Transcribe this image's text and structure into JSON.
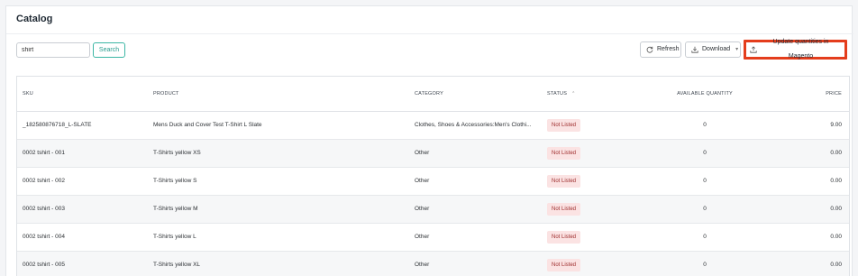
{
  "page": {
    "title": "Catalog"
  },
  "search": {
    "value": "shirt",
    "button_label": "Search"
  },
  "toolbar": {
    "refresh_label": "Refresh",
    "download_label": "Download",
    "update_label": "Update quantities in Magento"
  },
  "table": {
    "headers": {
      "sku": "SKU",
      "product": "PRODUCT",
      "category": "CATEGORY",
      "status": "STATUS",
      "available_quantity": "AVAILABLE QUANTITY",
      "price": "PRICE"
    },
    "rows": [
      {
        "sku": "_182580876718_L-SLATE",
        "product": "Mens Duck and Cover Test T-Shirt L Slate",
        "category": "Clothes, Shoes & Accessories:Men's Clothi...",
        "status": "Not Listed",
        "quantity": "0",
        "price": "9.00"
      },
      {
        "sku": "0002 tshirt - 001",
        "product": "T-Shirts yellow XS",
        "category": "Other",
        "status": "Not Listed",
        "quantity": "0",
        "price": "0.00"
      },
      {
        "sku": "0002 tshirt - 002",
        "product": "T-Shirts yellow S",
        "category": "Other",
        "status": "Not Listed",
        "quantity": "0",
        "price": "0.00"
      },
      {
        "sku": "0002 tshirt - 003",
        "product": "T-Shirts yellow M",
        "category": "Other",
        "status": "Not Listed",
        "quantity": "0",
        "price": "0.00"
      },
      {
        "sku": "0002 tshirt - 004",
        "product": "T-Shirts yellow L",
        "category": "Other",
        "status": "Not Listed",
        "quantity": "0",
        "price": "0.00"
      },
      {
        "sku": "0002 tshirt - 005",
        "product": "T-Shirts yellow XL",
        "category": "Other",
        "status": "Not Listed",
        "quantity": "0",
        "price": "0.00"
      }
    ]
  },
  "colors": {
    "accent": "#2a9d8f",
    "highlight_border": "#e43d1c",
    "status_badge_bg": "#fbe3e3",
    "status_badge_text": "#9c2a2a"
  },
  "icons": {
    "refresh": "refresh-icon",
    "download": "download-icon",
    "upload": "upload-icon",
    "sort": "sort-ascending-icon"
  }
}
